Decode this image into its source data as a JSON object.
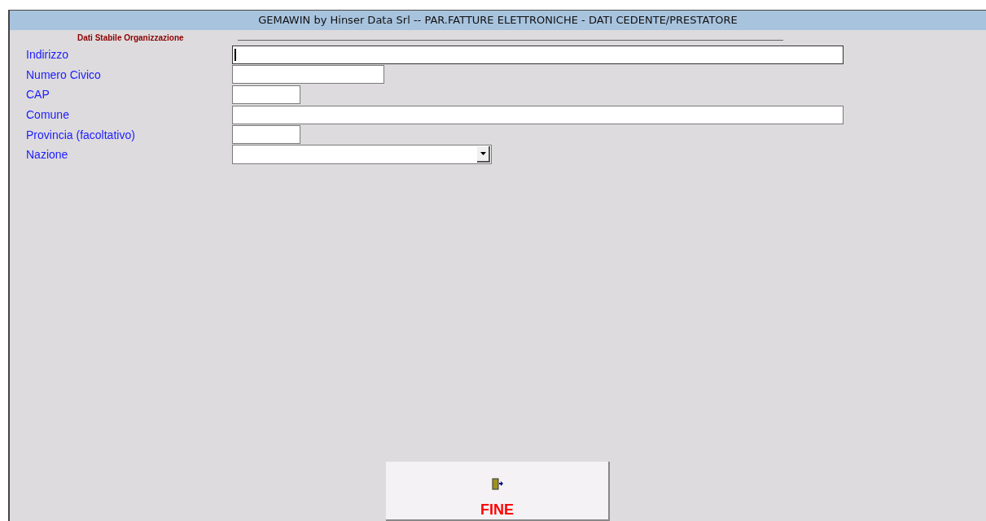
{
  "window": {
    "title": "GEMAWIN by Hinser Data Srl -- PAR.FATTURE ELETTRONICHE - DATI CEDENTE/PRESTATORE"
  },
  "section": {
    "title": "Dati Stabile Organizzazione"
  },
  "fields": [
    {
      "label": "Indirizzo",
      "kind": "text",
      "focused": true
    },
    {
      "label": "Numero Civico",
      "kind": "text",
      "focused": false
    },
    {
      "label": "CAP",
      "kind": "text",
      "focused": false
    },
    {
      "label": "Comune",
      "kind": "text",
      "focused": false
    },
    {
      "label": "Provincia (facoltativo)",
      "kind": "text",
      "focused": false
    },
    {
      "label": "Nazione",
      "kind": "dropdown",
      "focused": false
    }
  ],
  "button": {
    "label": "FINE"
  }
}
